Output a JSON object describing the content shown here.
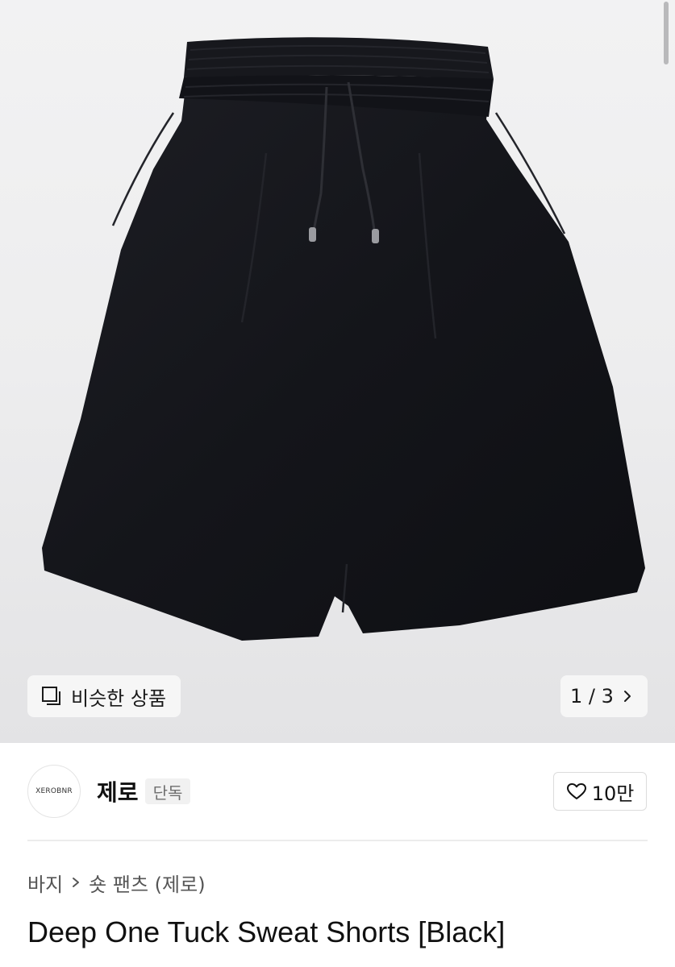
{
  "gallery": {
    "image_alt": "black sweat shorts",
    "similar_label": "비슷한 상품",
    "pager": "1 / 3"
  },
  "brand": {
    "logo_text": "XEROBNR",
    "name": "제로",
    "badge": "단독",
    "likes": "10만"
  },
  "breadcrumb": {
    "category": "바지",
    "subcategory": "숏 팬츠 (제로)"
  },
  "product": {
    "title": "Deep One Tuck Sweat Shorts [Black]"
  },
  "colors": {
    "hero_bg": "#eeeeef",
    "garment": "#14151a",
    "chip_bg": "#f6f6f6",
    "badge_bg": "#f1f1f1"
  },
  "icons": [
    "similar-items-icon",
    "chevron-right-icon",
    "heart-icon"
  ]
}
